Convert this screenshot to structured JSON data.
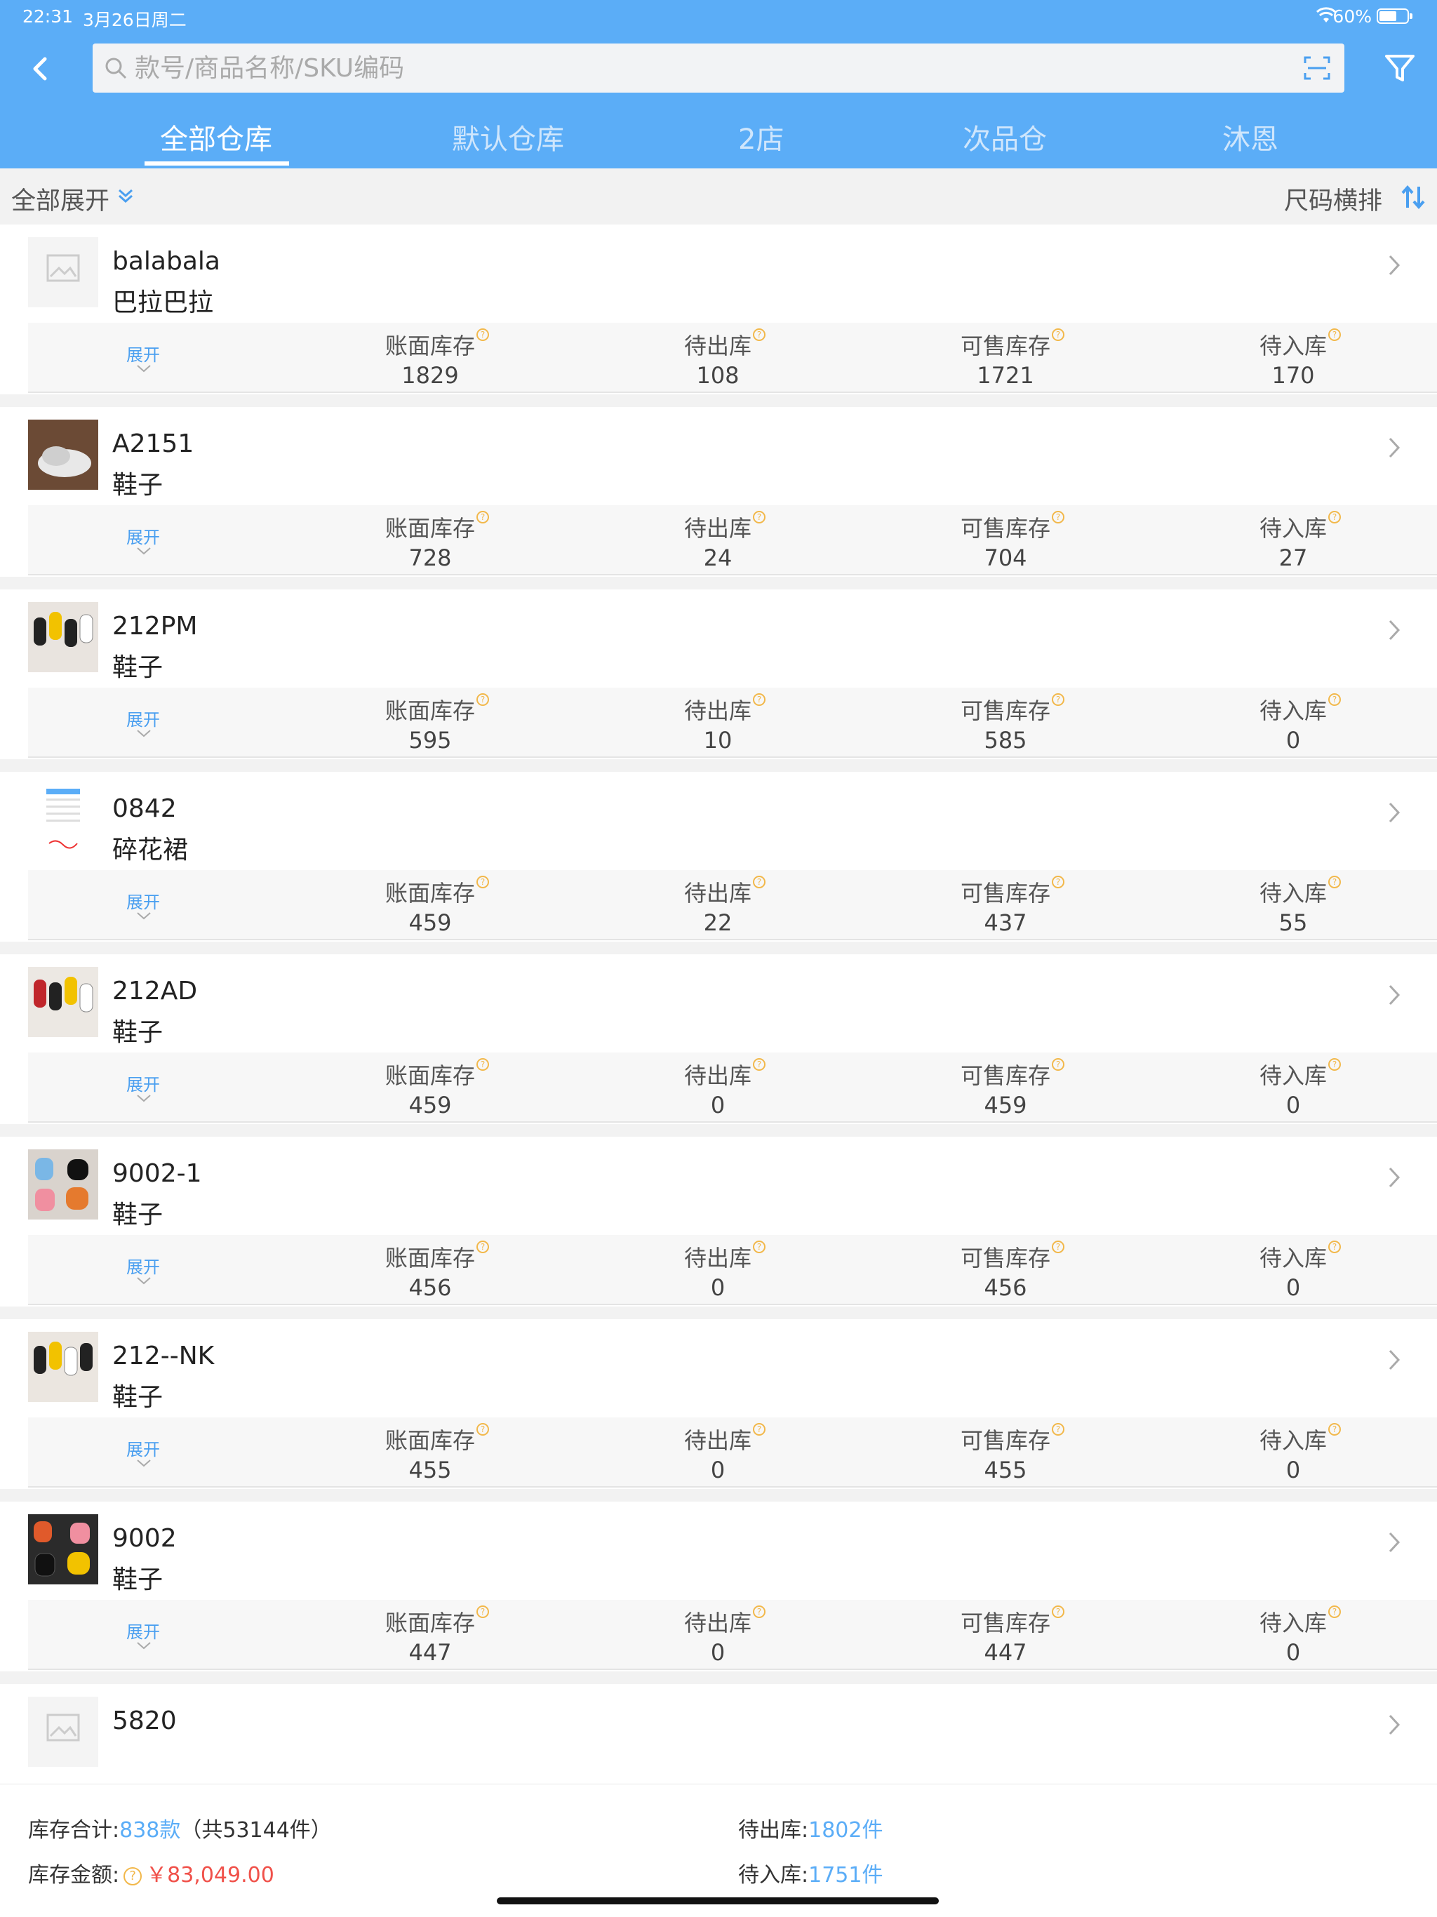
{
  "status": {
    "time": "22:31",
    "date": "3月26日周二",
    "battery": "60%"
  },
  "search": {
    "placeholder": "款号/商品名称/SKU编码"
  },
  "tabs": [
    "全部仓库",
    "默认仓库",
    "2店",
    "次品仓",
    "沐恩"
  ],
  "toolbar": {
    "expand_all": "全部展开",
    "size_sort": "尺码横排"
  },
  "stat_labels": {
    "book": "账面库存",
    "out": "待出库",
    "sale": "可售库存",
    "in": "待入库"
  },
  "expand_label": "展开",
  "products": [
    {
      "code": "balabala",
      "category": "巴拉巴拉",
      "book": "1829",
      "out": "108",
      "sale": "1721",
      "in": "170"
    },
    {
      "code": "A2151",
      "category": "鞋子",
      "book": "728",
      "out": "24",
      "sale": "704",
      "in": "27"
    },
    {
      "code": "212PM",
      "category": "鞋子",
      "book": "595",
      "out": "10",
      "sale": "585",
      "in": "0"
    },
    {
      "code": "0842",
      "category": "碎花裙",
      "book": "459",
      "out": "22",
      "sale": "437",
      "in": "55"
    },
    {
      "code": "212AD",
      "category": "鞋子",
      "book": "459",
      "out": "0",
      "sale": "459",
      "in": "0"
    },
    {
      "code": "9002-1",
      "category": "鞋子",
      "book": "456",
      "out": "0",
      "sale": "456",
      "in": "0"
    },
    {
      "code": "212--NK",
      "category": "鞋子",
      "book": "455",
      "out": "0",
      "sale": "455",
      "in": "0"
    },
    {
      "code": "9002",
      "category": "鞋子",
      "book": "447",
      "out": "0",
      "sale": "447",
      "in": "0"
    },
    {
      "code": "5820",
      "category": ""
    }
  ],
  "footer": {
    "total_label": "库存合计:",
    "total_styles": "838款",
    "total_pieces": "（共53144件）",
    "amount_label": "库存金额:",
    "amount_value": "￥83,049.00",
    "out_label": "待出库:",
    "out_value": "1802件",
    "in_label": "待入库:",
    "in_value": "1751件"
  }
}
